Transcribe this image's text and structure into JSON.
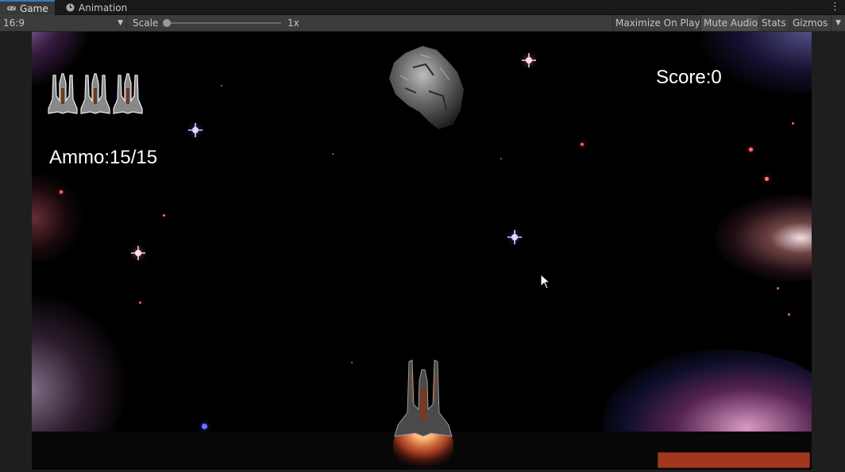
{
  "tabs": [
    {
      "label": "Game",
      "icon": "gamepad-icon",
      "active": true
    },
    {
      "label": "Animation",
      "icon": "clock-icon",
      "active": false
    }
  ],
  "toolbar": {
    "aspect": "16:9",
    "scale_label": "Scale",
    "scale_value": "1x",
    "maximize": "Maximize On Play",
    "mute": "Mute Audio",
    "stats": "Stats",
    "gizmos": "Gizmos"
  },
  "hud": {
    "score": "Score:0",
    "ammo": "Ammo:15/15",
    "lives": 3,
    "health_fraction": 1.0
  },
  "colors": {
    "health": "#a0381d",
    "accent": "#3a79bb"
  }
}
